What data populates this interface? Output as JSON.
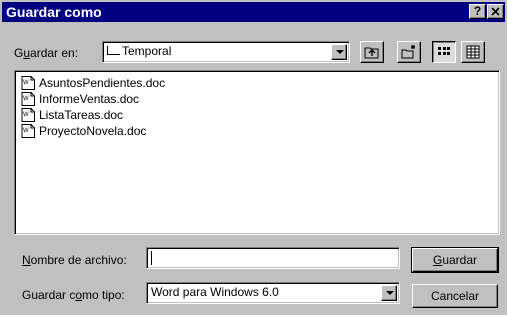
{
  "window": {
    "title": "Guardar como",
    "help_label": "?",
    "close_label": "✕"
  },
  "location": {
    "label_pre": "G",
    "label_ul": "u",
    "label_post": "ardar en:",
    "value": "Temporal",
    "icon": "folder-icon"
  },
  "toolbar": [
    {
      "name": "up-folder-icon"
    },
    {
      "name": "new-folder-icon"
    },
    {
      "name": "list-view-icon",
      "pressed": true
    },
    {
      "name": "details-view-icon"
    }
  ],
  "files": [
    {
      "name": "AsuntosPendientes.doc",
      "icon": "word-document-icon"
    },
    {
      "name": "InformeVentas.doc",
      "icon": "word-document-icon"
    },
    {
      "name": "ListaTareas.doc",
      "icon": "word-document-icon"
    },
    {
      "name": "ProyectoNovela.doc",
      "icon": "word-document-icon"
    }
  ],
  "filename": {
    "label_ul": "N",
    "label_post": "ombre de archivo:",
    "value": ""
  },
  "filetype": {
    "label_pre": "Guardar c",
    "label_ul": "o",
    "label_post": "mo tipo:",
    "value": "Word para Windows 6.0"
  },
  "buttons": {
    "save_ul": "G",
    "save_post": "uardar",
    "cancel": "Cancelar"
  }
}
